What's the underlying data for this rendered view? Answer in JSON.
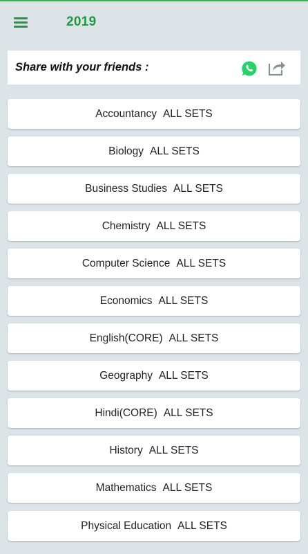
{
  "app_bar": {
    "title": "2019",
    "menu_icon": "hamburger-menu-icon",
    "accent_color": "#1f9a3d"
  },
  "share": {
    "label": "Share with your friends :",
    "whatsapp_icon": "whatsapp-icon",
    "share_icon": "share-icon",
    "whatsapp_color": "#25d366"
  },
  "subjects": [
    {
      "name": "Accountancy",
      "suffix": "ALL SETS"
    },
    {
      "name": "Biology",
      "suffix": "ALL SETS"
    },
    {
      "name": "Business Studies",
      "suffix": "ALL SETS"
    },
    {
      "name": "Chemistry",
      "suffix": "ALL SETS"
    },
    {
      "name": "Computer Science",
      "suffix": "ALL SETS"
    },
    {
      "name": "Economics",
      "suffix": "ALL SETS"
    },
    {
      "name": "English(CORE)",
      "suffix": "ALL SETS"
    },
    {
      "name": "Geography",
      "suffix": "ALL SETS"
    },
    {
      "name": "Hindi(CORE)",
      "suffix": "ALL SETS"
    },
    {
      "name": "History",
      "suffix": "ALL SETS"
    },
    {
      "name": "Mathematics",
      "suffix": "ALL SETS"
    },
    {
      "name": "Physical Education",
      "suffix": "ALL SETS"
    }
  ]
}
